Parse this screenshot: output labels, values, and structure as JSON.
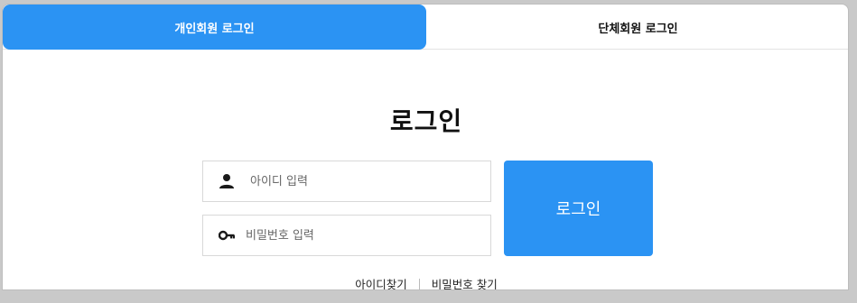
{
  "tabs": {
    "individual": "개인회원 로그인",
    "group": "단체회원 로그인"
  },
  "title": "로그인",
  "id_field": {
    "placeholder": "아이디 입력",
    "value": ""
  },
  "password_field": {
    "placeholder": "비밀번호 입력",
    "value": ""
  },
  "login_button": "로그인",
  "links": {
    "find_id": "아이디찾기",
    "find_password": "비밀번호 찾기"
  },
  "colors": {
    "accent": "#2b93f3",
    "background": "#c9c9c9"
  },
  "icons": {
    "id_field": "person-icon",
    "password_field": "key-icon"
  }
}
